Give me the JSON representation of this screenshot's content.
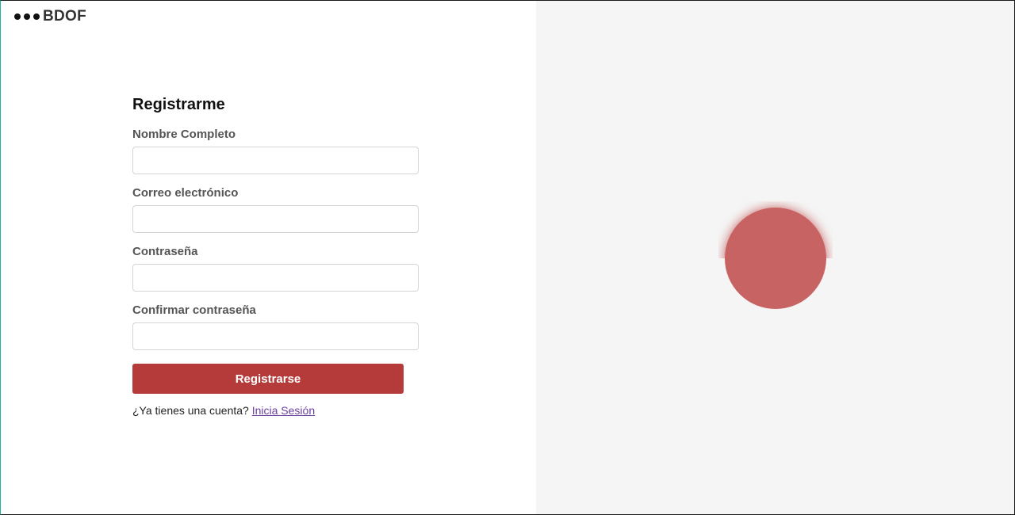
{
  "brand": {
    "name": "BDOF"
  },
  "form": {
    "title": "Registrarme",
    "fields": [
      {
        "label": "Nombre Completo",
        "value": ""
      },
      {
        "label": "Correo electrónico",
        "value": ""
      },
      {
        "label": "Contraseña",
        "value": ""
      },
      {
        "label": "Confirmar contraseña",
        "value": ""
      }
    ],
    "submit_label": "Registrarse",
    "login_prompt": "¿Ya tienes una cuenta?",
    "login_link": "Inicia Sesión"
  },
  "colors": {
    "accent": "#b53b3b",
    "loader": "#c86363",
    "link": "#6b3fa0",
    "right_panel_bg": "#f5f5f5"
  },
  "icons": {
    "brand": "three-dots-icon",
    "loader": "loading-spinner-icon"
  }
}
